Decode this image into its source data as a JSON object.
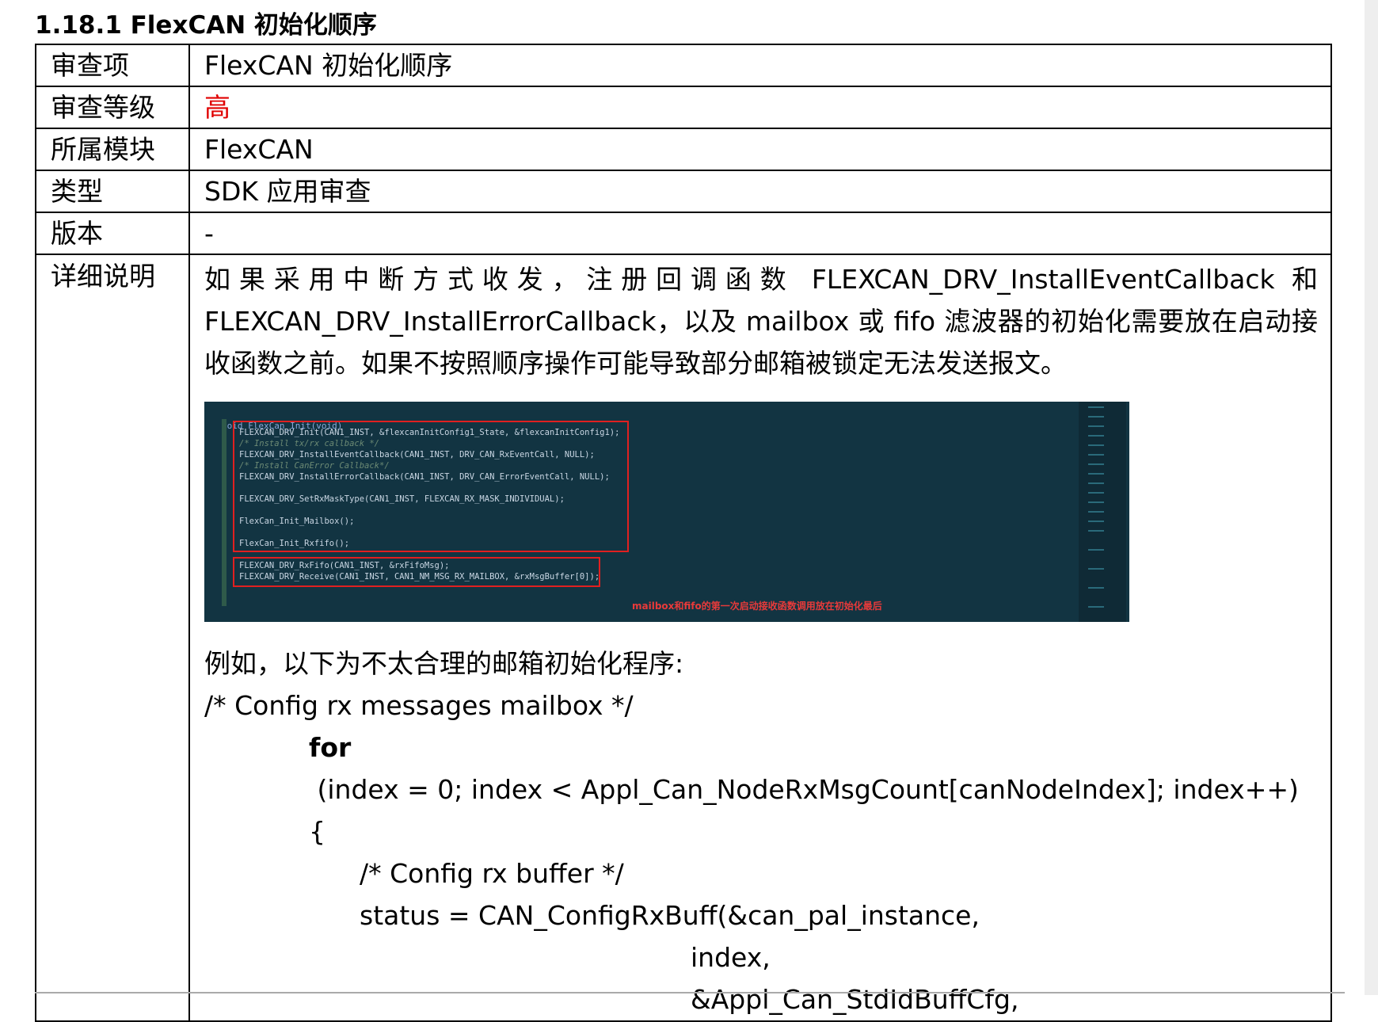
{
  "heading": "1.18.1 FlexCAN 初始化顺序",
  "rows": [
    {
      "label": "审查项",
      "value": "FlexCAN 初始化顺序"
    },
    {
      "label": "审查等级",
      "value": "高"
    },
    {
      "label": "所属模块",
      "value": "FlexCAN"
    },
    {
      "label": "类型",
      "value": "SDK 应用审查"
    },
    {
      "label": "版本",
      "value": "-"
    }
  ],
  "detail": {
    "label": "详细说明",
    "paragraph": "如果采用中断方式收发，注册回调函数 FLEXCAN_DRV_InstallEventCallback 和 FLEXCAN_DRV_InstallErrorCallback，以及 mailbox 或 fifo 滤波器的初始化需要放在启动接收函数之前。如果不按照顺序操作可能导致部分邮箱被锁定无法发送报文。",
    "screenshot": {
      "header": "void FlexCan_Init(void)",
      "lines": [
        "FLEXCAN_DRV_Init(CAN1_INST, &flexcanInitConfig1_State, &flexcanInitConfig1);",
        "/* Install tx/rx callback */",
        "FLEXCAN_DRV_InstallEventCallback(CAN1_INST, DRV_CAN_RxEventCall, NULL);",
        "/* Install CanError Callback*/",
        "FLEXCAN_DRV_InstallErrorCallback(CAN1_INST, DRV_CAN_ErrorEventCall, NULL);",
        "FLEXCAN_DRV_SetRxMaskType(CAN1_INST, FLEXCAN_RX_MASK_INDIVIDUAL);",
        "FlexCan_Init_Mailbox();",
        "FlexCan_Init_Rxfifo();",
        "FLEXCAN_DRV_RxFifo(CAN1_INST, &rxFifoMsg);",
        "FLEXCAN_DRV_Receive(CAN1_INST, CAN1_NM_MSG_RX_MAILBOX, &rxMsgBuffer[0]);"
      ],
      "annotation": "mailbox和fifo的第一次启动接收函数调用放在初始化最后"
    },
    "example_intro": "例如，以下为不太合理的邮箱初始化程序:",
    "code": {
      "comment1": "/* Config rx messages mailbox */",
      "for_kw": "for",
      "for_rest": " (index = 0; index < Appl_Can_NodeRxMsgCount[canNodeIndex]; index++)",
      "brace": "{",
      "comment2": "/* Config rx buffer */",
      "status_line": "status = CAN_ConfigRxBuff(&can_pal_instance,",
      "arg1": "index,",
      "arg2": "&Appl_Can_StdIdBuffCfg,"
    }
  }
}
